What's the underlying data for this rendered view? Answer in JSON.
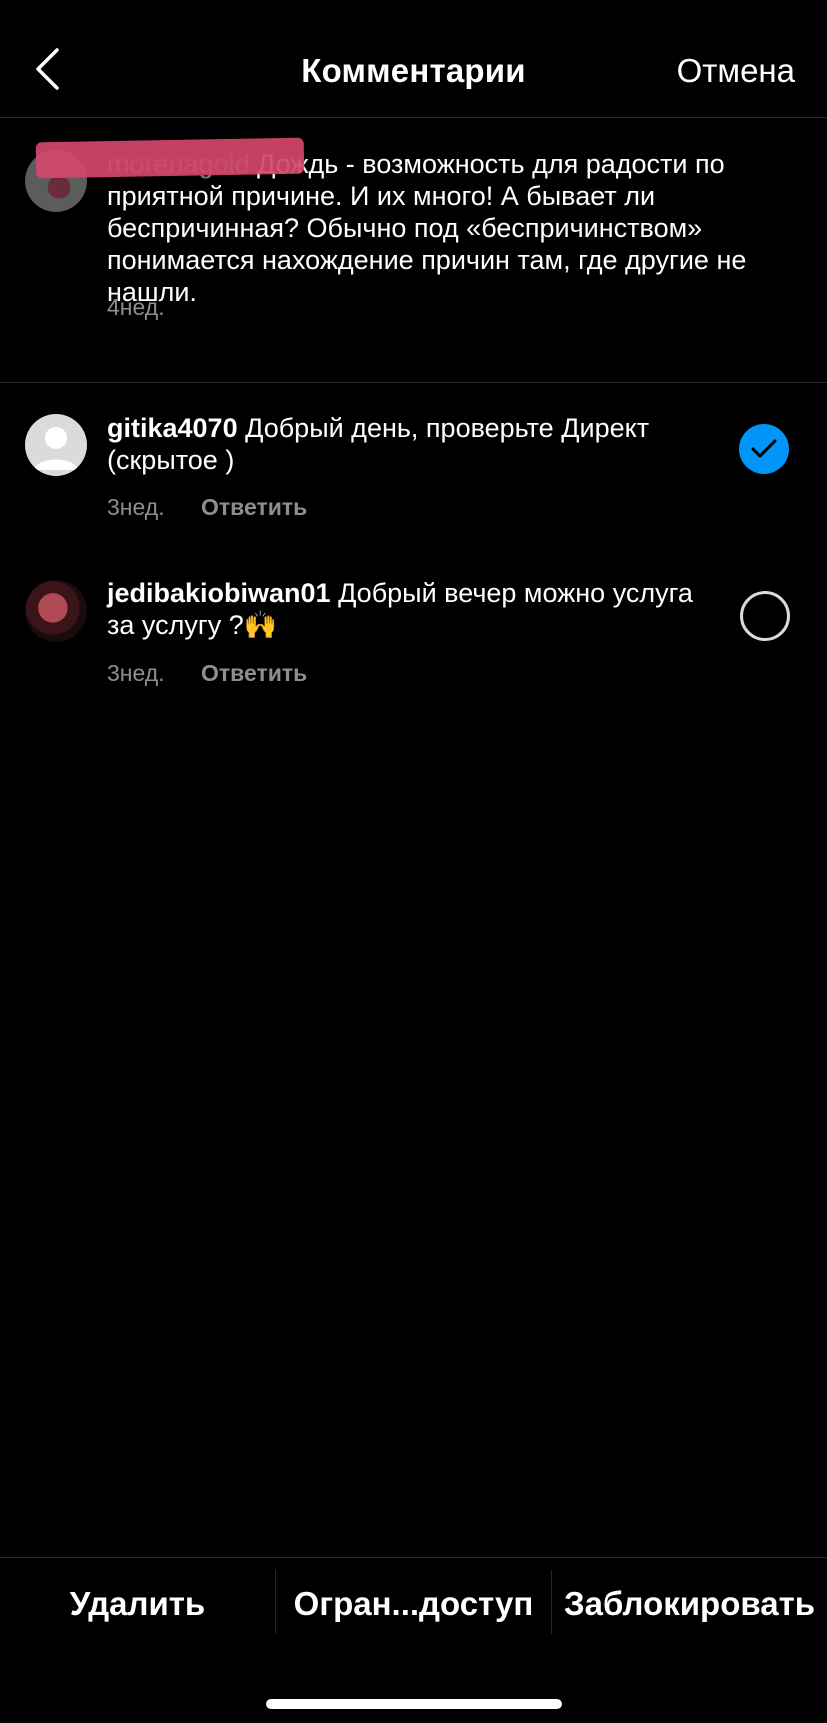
{
  "header": {
    "title": "Комментарии",
    "cancel_label": "Отмена",
    "back_icon": "chevron-left-icon"
  },
  "caption": {
    "username": "morenagold",
    "text": "Дождь - возможность для радости по приятной причине. И их много! А бывает ли беспричинная? Обычно под «беспричинством» понимается нахождение причин там, где другие не нашли.",
    "time": "4нед."
  },
  "comments": [
    {
      "username": "gitika4070",
      "text": "Добрый день, проверьте Директ (скрытое )",
      "time": "3нед.",
      "reply_label": "Ответить",
      "selected": true
    },
    {
      "username": "jedibakiobiwan01",
      "text": "Добрый вечер  можно услуга за услугу ?🙌",
      "time": "3нед.",
      "reply_label": "Ответить",
      "selected": false
    }
  ],
  "actions": {
    "delete": "Удалить",
    "restrict": "Огран...доступ",
    "block": "Заблокировать"
  },
  "colors": {
    "background": "#000000",
    "accent": "#0095f6",
    "secondary_text": "#8e8e8e",
    "redaction": "#d4486d"
  }
}
